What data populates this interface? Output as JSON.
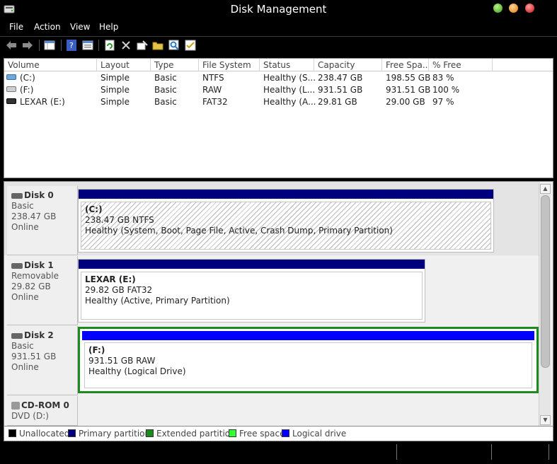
{
  "window": {
    "title": "Disk Management"
  },
  "menu": [
    "File",
    "Action",
    "View",
    "Help"
  ],
  "toolbar": {
    "icons": [
      "back-arrow-icon",
      "forward-arrow-icon",
      "console-tree-icon",
      "help-icon",
      "properties-icon",
      "refresh-icon",
      "delete-icon",
      "wizard-icon",
      "open-folder-icon",
      "search-icon",
      "checklist-icon"
    ]
  },
  "volume_list": {
    "columns": [
      "Volume",
      "Layout",
      "Type",
      "File System",
      "Status",
      "Capacity",
      "Free Spa...",
      "% Free"
    ],
    "rows": [
      {
        "volume": "(C:)",
        "layout": "Simple",
        "type": "Basic",
        "fs": "NTFS",
        "status": "Healthy (S...",
        "capacity": "238.47 GB",
        "free": "198.55 GB",
        "pct": "83 %",
        "icon_color": "#6fa8dc"
      },
      {
        "volume": "(F:)",
        "layout": "Simple",
        "type": "Basic",
        "fs": "RAW",
        "status": "Healthy (L...",
        "capacity": "931.51 GB",
        "free": "931.51 GB",
        "pct": "100 %",
        "icon_color": "#9e9e9e"
      },
      {
        "volume": "LEXAR (E:)",
        "layout": "Simple",
        "type": "Basic",
        "fs": "FAT32",
        "status": "Healthy (A...",
        "capacity": "29.81 GB",
        "free": "29.00 GB",
        "pct": "97 %",
        "icon_color": "#333333"
      }
    ]
  },
  "disks": [
    {
      "name": "Disk 0",
      "kind": "Basic",
      "size": "238.47 GB",
      "state": "Online",
      "partition": {
        "name": "(C:)",
        "info": "238.47 GB NTFS",
        "status": "Healthy (System, Boot, Page File, Active, Crash Dump, Primary Partition)",
        "bar_color": "#00007f"
      }
    },
    {
      "name": "Disk 1",
      "kind": "Removable",
      "size": "29.82 GB",
      "state": "Online",
      "partition": {
        "name": "LEXAR  (E:)",
        "info": "29.82 GB FAT32",
        "status": "Healthy (Active, Primary Partition)",
        "bar_color": "#00007f"
      }
    },
    {
      "name": "Disk 2",
      "kind": "Basic",
      "size": "931.51 GB",
      "state": "Online",
      "partition": {
        "name": "(F:)",
        "info": "931.51 GB RAW",
        "status": "Healthy (Logical Drive)",
        "bar_color": "#0000ff",
        "frame_color": "#1c8a1c"
      }
    },
    {
      "name": "CD-ROM 0",
      "kind": "DVD (D:)"
    }
  ],
  "legend": [
    {
      "label": "Unallocated",
      "color": "#000000"
    },
    {
      "label": "Primary partition",
      "color": "#00007f"
    },
    {
      "label": "Extended partition",
      "color": "#1c8a1c"
    },
    {
      "label": "Free space",
      "color": "#33ff33"
    },
    {
      "label": "Logical drive",
      "color": "#0000ff"
    }
  ]
}
